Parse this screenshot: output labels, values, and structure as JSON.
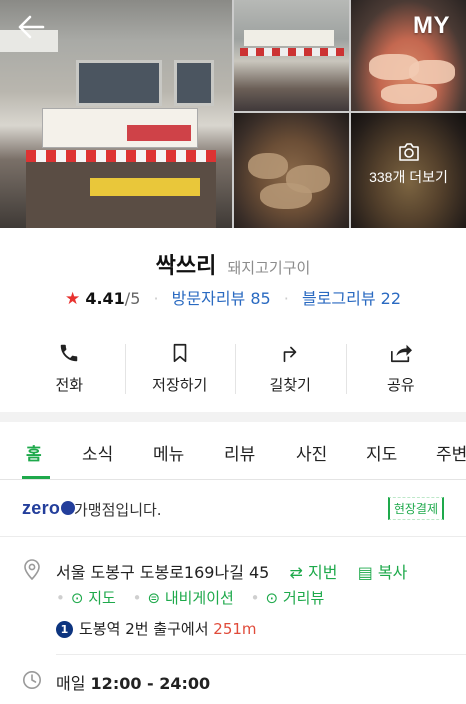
{
  "header": {
    "back_icon": "arrow-left-icon",
    "my_label": "MY"
  },
  "gallery": {
    "more_label": "338개 더보기",
    "camera_icon": "camera-icon"
  },
  "place": {
    "name": "싹쓰리",
    "category": "돼지고기구이",
    "rating": "4.41",
    "rating_max": "/5",
    "visitor_reviews": "방문자리뷰 85",
    "blog_reviews": "블로그리뷰 22"
  },
  "actions": [
    {
      "label": "전화",
      "icon": "phone-icon"
    },
    {
      "label": "저장하기",
      "icon": "bookmark-icon"
    },
    {
      "label": "길찾기",
      "icon": "directions-icon"
    },
    {
      "label": "공유",
      "icon": "share-icon"
    }
  ],
  "tabs": [
    "홈",
    "소식",
    "메뉴",
    "리뷰",
    "사진",
    "지도",
    "주변"
  ],
  "active_tab": "홈",
  "zero_pay": {
    "logo": "zero",
    "text": "가맹점입니다.",
    "badge": "현장결제"
  },
  "address": {
    "text": "서울 도봉구 도봉로169나길 45",
    "jibun": "지번",
    "copy": "복사",
    "links": [
      "지도",
      "내비게이션",
      "거리뷰"
    ],
    "subway_line": "1",
    "subway_station": "도봉역",
    "subway_exit": "2번 출구에서",
    "subway_distance": "251m"
  },
  "hours": {
    "days": "매일",
    "time": "12:00 - 24:00"
  },
  "colors": {
    "accent_green": "#1ea94b",
    "review_blue": "#2a6ac1",
    "star_red": "#e8322f",
    "distance_red": "#e04b3a",
    "subway_line1": "#0d347f"
  }
}
